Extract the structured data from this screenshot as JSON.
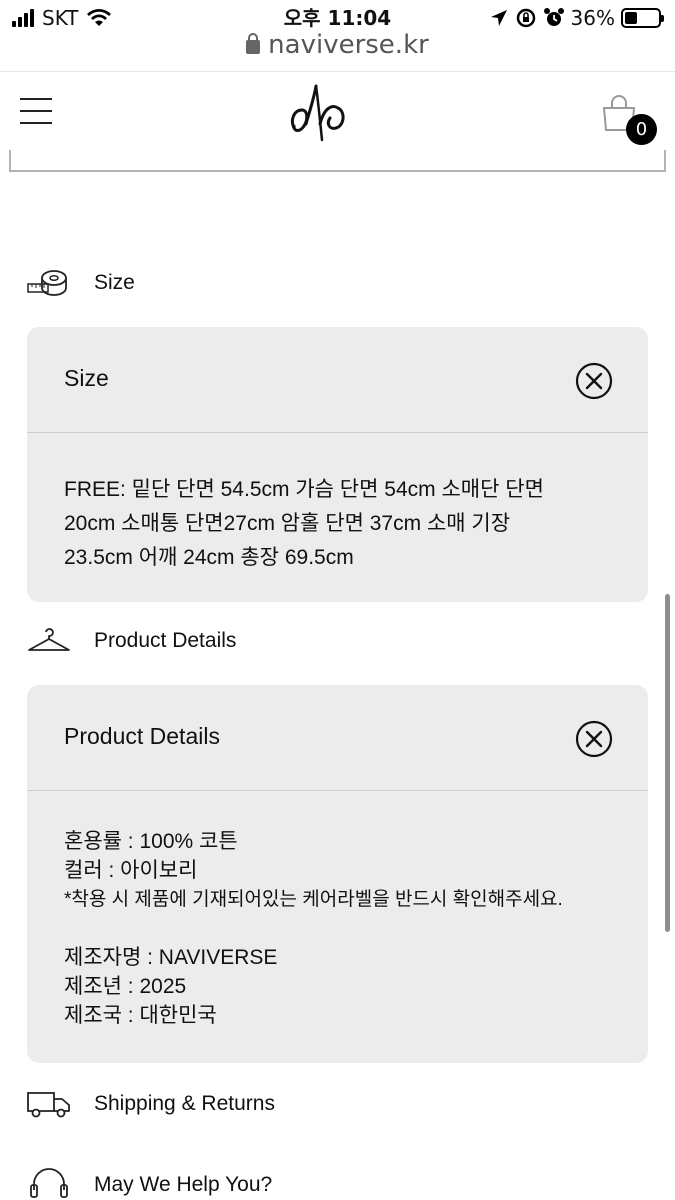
{
  "status_bar": {
    "carrier": "SKT",
    "time": "오후 11:04",
    "battery_percent": "36%",
    "battery_level": 0.36,
    "icons": [
      "signal-icon",
      "wifi-icon",
      "location-arrow-icon",
      "screen-rotation-lock-icon",
      "alarm-icon",
      "battery-icon"
    ]
  },
  "browser": {
    "url": "naviverse.kr"
  },
  "header": {
    "cart_count": "0"
  },
  "sections": {
    "size": {
      "label": "Size",
      "panel_title": "Size",
      "lines": [
        "FREE: 밑단 단면 54.5cm 가슴 단면 54cm 소매단 단면",
        "20cm 소매통 단면27cm 암홀 단면 37cm 소매 기장",
        "23.5cm 어깨 24cm 총장 69.5cm"
      ]
    },
    "product_details": {
      "label": "Product Details",
      "panel_title": "Product Details",
      "lines": [
        "혼용률 : 100% 코튼",
        "컬러 : 아이보리",
        "*착용 시 제품에 기재되어있는 케어라벨을 반드시 확인해주세요.",
        "제조자명 : NAVIVERSE",
        "제조년 : 2025",
        "제조국 : 대한민국"
      ]
    },
    "shipping": {
      "label": "Shipping & Returns"
    },
    "help": {
      "label": "May We Help You?"
    }
  }
}
